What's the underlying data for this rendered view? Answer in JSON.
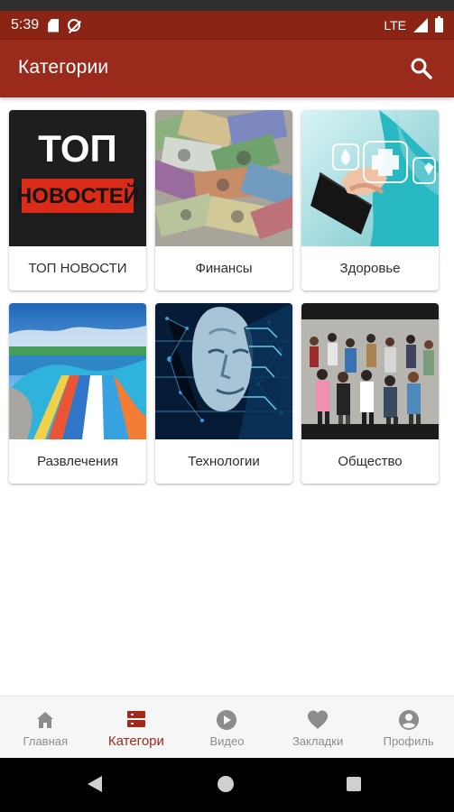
{
  "status_bar": {
    "time": "5:39",
    "network": "LTE"
  },
  "app_bar": {
    "title": "Категории",
    "search_icon": "search-icon"
  },
  "categories": [
    {
      "label": "ТОП НОВОСТИ",
      "image_text": [
        "ТОП",
        "НОВОСТЕЙ"
      ]
    },
    {
      "label": "Финансы"
    },
    {
      "label": "Здоровье"
    },
    {
      "label": "Развлечения"
    },
    {
      "label": "Технологии"
    },
    {
      "label": "Общество"
    }
  ],
  "bottom_nav": {
    "items": [
      {
        "label": "Главная",
        "icon": "home-icon"
      },
      {
        "label": "Категори",
        "icon": "categories-icon",
        "active": true
      },
      {
        "label": "Видео",
        "icon": "play-icon"
      },
      {
        "label": "Закладки",
        "icon": "heart-icon"
      },
      {
        "label": "Профиль",
        "icon": "profile-icon"
      }
    ]
  },
  "colors": {
    "status_bar": "#8a2414",
    "app_bar": "#9a2b1c",
    "accent": "#a12a1b",
    "inactive_nav": "#8c8c8c"
  }
}
